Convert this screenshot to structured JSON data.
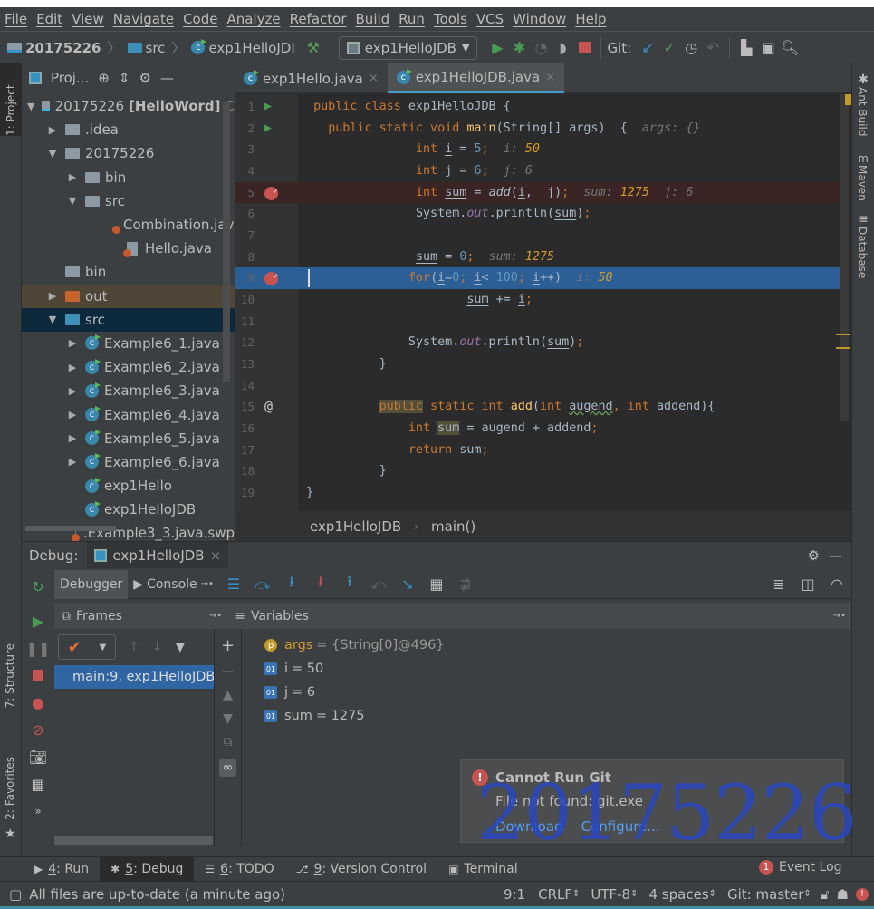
{
  "menu": [
    "File",
    "Edit",
    "View",
    "Navigate",
    "Code",
    "Analyze",
    "Refactor",
    "Build",
    "Run",
    "Tools",
    "VCS",
    "Window",
    "Help"
  ],
  "nav": {
    "project": "20175226",
    "folder": "src",
    "file": "exp1HelloJDI",
    "run_config": "exp1HelloJDB",
    "git_label": "Git:"
  },
  "left_stripe": {
    "project": "1: Project",
    "structure": "7: Structure",
    "favorites": "2: Favorites"
  },
  "right_stripe": {
    "ant": "Ant Build",
    "maven": "Maven",
    "database": "Database"
  },
  "project_panel": {
    "title": "Proj...",
    "tree": [
      {
        "label": "20175226",
        "bold": "[HelloWord]",
        "suffix": "C",
        "depth": 0,
        "arrow": "down",
        "icon": "module"
      },
      {
        "label": ".idea",
        "depth": 1,
        "arrow": "right",
        "icon": "folder"
      },
      {
        "label": "20175226",
        "depth": 1,
        "arrow": "down",
        "icon": "folder"
      },
      {
        "label": "bin",
        "depth": 2,
        "arrow": "right",
        "icon": "folder"
      },
      {
        "label": "src",
        "depth": 2,
        "arrow": "down",
        "icon": "folder"
      },
      {
        "label": "Combination.java",
        "depth": 3,
        "arrow": "",
        "icon": "java-file"
      },
      {
        "label": "Hello.java",
        "depth": 3,
        "arrow": "",
        "icon": "java-file"
      },
      {
        "label": "bin",
        "depth": 1,
        "arrow": "",
        "icon": "folder"
      },
      {
        "label": "out",
        "depth": 1,
        "arrow": "right",
        "icon": "folder-orange",
        "state": "excluded"
      },
      {
        "label": "src",
        "depth": 1,
        "arrow": "down",
        "icon": "folder-blue",
        "state": "selected"
      },
      {
        "label": "Example6_1.java",
        "depth": 2,
        "arrow": "right",
        "icon": "class"
      },
      {
        "label": "Example6_2.java",
        "depth": 2,
        "arrow": "right",
        "icon": "class"
      },
      {
        "label": "Example6_3.java",
        "depth": 2,
        "arrow": "right",
        "icon": "class"
      },
      {
        "label": "Example6_4.java",
        "depth": 2,
        "arrow": "right",
        "icon": "class"
      },
      {
        "label": "Example6_5.java",
        "depth": 2,
        "arrow": "right",
        "icon": "class"
      },
      {
        "label": "Example6_6.java",
        "depth": 2,
        "arrow": "right",
        "icon": "class"
      },
      {
        "label": "exp1Hello",
        "depth": 2,
        "arrow": "",
        "icon": "class"
      },
      {
        "label": "exp1HelloJDB",
        "depth": 2,
        "arrow": "",
        "icon": "class"
      },
      {
        "label": ".Example3_3.java.swp",
        "depth": 2,
        "arrow": "",
        "icon": "file"
      }
    ]
  },
  "editor": {
    "tabs": [
      {
        "label": "exp1Hello.java",
        "active": false
      },
      {
        "label": "exp1HelloJDB.java",
        "active": true
      }
    ],
    "lines": [
      {
        "n": "1",
        "gutter": "run",
        "t": [
          [
            " ",
            ""
          ],
          [
            "public class ",
            "kw"
          ],
          [
            "exp1HelloJDB {",
            "pl"
          ]
        ]
      },
      {
        "n": "2",
        "gutter": "run",
        "t": [
          [
            "   ",
            ""
          ],
          [
            "public static void ",
            "kw"
          ],
          [
            "main",
            "fn"
          ],
          [
            "(String[] args)  {  ",
            "pl"
          ],
          [
            "args: {}",
            "hint"
          ]
        ]
      },
      {
        "n": "3",
        "t": [
          [
            "               ",
            ""
          ],
          [
            "int ",
            "kw"
          ],
          [
            "i",
            "pl u"
          ],
          [
            " = ",
            "pl"
          ],
          [
            "5",
            "num"
          ],
          [
            ";  ",
            "kw"
          ],
          [
            "i: ",
            "hint"
          ],
          [
            "50",
            "hv"
          ]
        ]
      },
      {
        "n": "4",
        "t": [
          [
            "               ",
            ""
          ],
          [
            "int ",
            "kw"
          ],
          [
            "j = ",
            "pl"
          ],
          [
            "6",
            "num"
          ],
          [
            ";  ",
            "kw"
          ],
          [
            "j: 6",
            "hint"
          ]
        ]
      },
      {
        "n": "5",
        "gutter": "breakpoint",
        "bg": "#3b2424",
        "t": [
          [
            "               ",
            ""
          ],
          [
            "int ",
            "kw"
          ],
          [
            "sum",
            "pl u"
          ],
          [
            " = ",
            "pl"
          ],
          [
            "add",
            "it"
          ],
          [
            "(",
            "pl"
          ],
          [
            "i",
            "pl u"
          ],
          [
            ",  j)",
            "pl"
          ],
          [
            ";  ",
            "kw"
          ],
          [
            "sum: ",
            "hint"
          ],
          [
            "1275",
            "hv"
          ],
          [
            "  j: 6",
            "hint"
          ]
        ]
      },
      {
        "n": "6",
        "t": [
          [
            "               ",
            ""
          ],
          [
            "System.",
            "pl"
          ],
          [
            "out",
            "st"
          ],
          [
            ".println(",
            "pl"
          ],
          [
            "sum",
            "pl u"
          ],
          [
            ")",
            "pl"
          ],
          [
            ";",
            "kw"
          ]
        ]
      },
      {
        "n": "7",
        "t": []
      },
      {
        "n": "8",
        "t": [
          [
            "               ",
            ""
          ],
          [
            "sum",
            "pl u"
          ],
          [
            " = ",
            "pl"
          ],
          [
            "0",
            "num"
          ],
          [
            ";  ",
            "kw"
          ],
          [
            "sum: ",
            "hint"
          ],
          [
            "1275",
            "hv"
          ]
        ]
      },
      {
        "n": "9",
        "gutter": "breakpoint-current",
        "bg": "#2d5f97",
        "t": [
          [
            "              ",
            ""
          ],
          [
            "for",
            "kw"
          ],
          [
            "(",
            "pl"
          ],
          [
            "i",
            "pl u"
          ],
          [
            "=",
            "pl"
          ],
          [
            "0",
            "num"
          ],
          [
            "; ",
            "kw"
          ],
          [
            "i",
            "pl u"
          ],
          [
            "< ",
            "pl"
          ],
          [
            "100",
            "num"
          ],
          [
            "; ",
            "kw"
          ],
          [
            "i",
            "pl u"
          ],
          [
            "++)  ",
            "pl"
          ],
          [
            "i: ",
            "hint"
          ],
          [
            "50",
            "hv"
          ]
        ]
      },
      {
        "n": "10",
        "t": [
          [
            "                      ",
            ""
          ],
          [
            "sum",
            "pl u"
          ],
          [
            " += ",
            "pl"
          ],
          [
            "i",
            "pl u"
          ],
          [
            ";",
            "kw"
          ]
        ]
      },
      {
        "n": "11",
        "t": []
      },
      {
        "n": "12",
        "t": [
          [
            "              ",
            ""
          ],
          [
            "System.",
            "pl"
          ],
          [
            "out",
            "st"
          ],
          [
            ".println(",
            "pl"
          ],
          [
            "sum",
            "pl u"
          ],
          [
            ")",
            "pl"
          ],
          [
            ";",
            "kw"
          ]
        ]
      },
      {
        "n": "13",
        "t": [
          [
            "          ",
            ""
          ],
          [
            "}",
            "pl"
          ]
        ]
      },
      {
        "n": "14",
        "t": []
      },
      {
        "n": "15",
        "gutter": "override",
        "t": [
          [
            "          ",
            ""
          ],
          [
            "public",
            "kw hl"
          ],
          [
            " static int ",
            "kw"
          ],
          [
            "add",
            "fn"
          ],
          [
            "(",
            "pl"
          ],
          [
            "int ",
            "kw"
          ],
          [
            "augend",
            "pl wavy"
          ],
          [
            ", ",
            "kw"
          ],
          [
            "int ",
            "kw"
          ],
          [
            "addend){",
            "pl"
          ]
        ]
      },
      {
        "n": "16",
        "t": [
          [
            "              ",
            ""
          ],
          [
            "int ",
            "kw"
          ],
          [
            "sum",
            "pl hl"
          ],
          [
            " = augend + addend",
            "pl"
          ],
          [
            ";",
            "kw"
          ]
        ]
      },
      {
        "n": "17",
        "t": [
          [
            "              ",
            ""
          ],
          [
            "return ",
            "kw"
          ],
          [
            "sum",
            "pl"
          ],
          [
            ";",
            "kw"
          ]
        ]
      },
      {
        "n": "18",
        "t": [
          [
            "          ",
            ""
          ],
          [
            "}",
            "pl"
          ]
        ]
      },
      {
        "n": "19",
        "t": [
          [
            "}",
            "pl"
          ]
        ]
      }
    ],
    "breadcrumb": [
      "exp1HelloJDB",
      "main()"
    ]
  },
  "debug": {
    "label": "Debug:",
    "session": "exp1HelloJDB",
    "tabs": {
      "debugger": "Debugger",
      "console": "Console"
    },
    "frames_title": "Frames",
    "variables_title": "Variables",
    "frame": "main:9, exp1HelloJDB",
    "variables": [
      {
        "icon": "p",
        "name": "args",
        "value": "= {String[0]@496}"
      },
      {
        "icon": "01",
        "name": "i",
        "value": "= 50"
      },
      {
        "icon": "01",
        "name": "j",
        "value": "= 6"
      },
      {
        "icon": "01",
        "name": "sum",
        "value": "= 1275"
      }
    ]
  },
  "notification": {
    "title": "Cannot Run Git",
    "body": "File not found: git.exe",
    "actions": [
      "Download",
      "Configure..."
    ]
  },
  "watermark": "20175226",
  "bottom_tabs": [
    {
      "key": "4",
      "label": ": Run"
    },
    {
      "key": "5",
      "label": ": Debug",
      "active": true
    },
    {
      "key": "6",
      "label": ": TODO"
    },
    {
      "key": "9",
      "label": ": Version Control"
    },
    {
      "key": "",
      "label": "Terminal"
    }
  ],
  "event_log": {
    "count": "1",
    "label": "Event Log"
  },
  "status": {
    "message": "All files are up-to-date (a minute ago)",
    "position": "9:1",
    "line_sep": "CRLF",
    "encoding": "UTF-8",
    "indent": "4 spaces",
    "git": "Git: master"
  },
  "colors": {
    "accent": "#4a9ec5",
    "breakpoint": "#c75450",
    "execution_line": "#2d5f97",
    "run_green": "#499c54"
  }
}
